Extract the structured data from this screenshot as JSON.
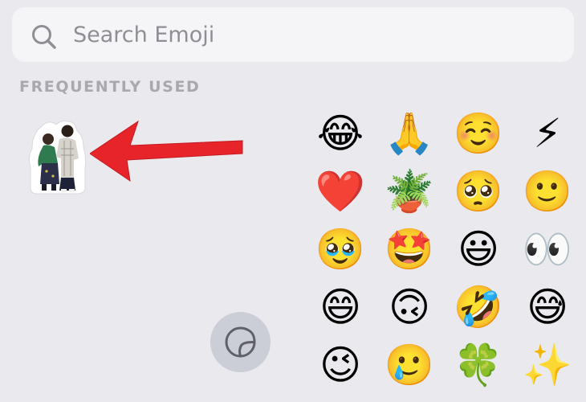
{
  "search": {
    "placeholder": "Search Emoji",
    "icon": "magnifying-glass"
  },
  "section": {
    "title": "FREQUENTLY USED"
  },
  "sticker": {
    "icon": "photo-sticker-two-people",
    "annotation": "red-arrow"
  },
  "sticker_toggle": {
    "icon": "sticker-peel-icon"
  },
  "emojis": [
    {
      "char": "😂",
      "name": "face-with-tears-of-joy"
    },
    {
      "char": "🙏",
      "name": "folded-hands"
    },
    {
      "char": "☺️",
      "name": "smiling-face"
    },
    {
      "char": "⚡",
      "name": "high-voltage"
    },
    {
      "char": "❤️",
      "name": "red-heart"
    },
    {
      "char": "🪴",
      "name": "potted-plant"
    },
    {
      "char": "🥺",
      "name": "pleading-face"
    },
    {
      "char": "🙂",
      "name": "slightly-smiling-face"
    },
    {
      "char": "🥹",
      "name": "face-holding-back-tears"
    },
    {
      "char": "🤩",
      "name": "star-struck"
    },
    {
      "char": "😃",
      "name": "grinning-face-big-eyes"
    },
    {
      "char": "👀",
      "name": "eyes"
    },
    {
      "char": "😄",
      "name": "grinning-face-smiling-eyes"
    },
    {
      "char": "🙃",
      "name": "upside-down-face"
    },
    {
      "char": "🤣",
      "name": "rolling-on-floor-laughing"
    },
    {
      "char": "😅",
      "name": "grinning-face-with-sweat"
    },
    {
      "char": "😉",
      "name": "winking-face"
    },
    {
      "char": "🥲",
      "name": "smiling-face-with-tear"
    },
    {
      "char": "🍀",
      "name": "four-leaf-clover"
    },
    {
      "char": "✨",
      "name": "sparkles"
    }
  ],
  "colors": {
    "background": "#e9e9ee",
    "search_field": "#f5f5f8",
    "placeholder": "#8e8e94",
    "section_header": "#a8a8ae",
    "toggle_bg": "#ccced7",
    "arrow": "#e8242b"
  }
}
